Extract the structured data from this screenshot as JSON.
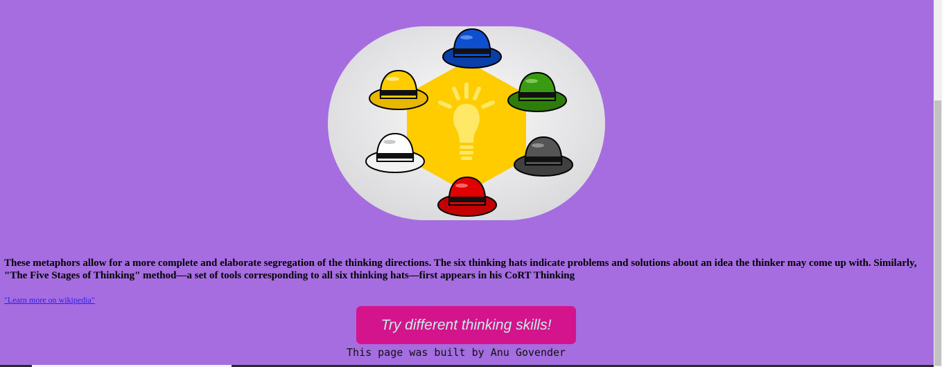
{
  "hero": {
    "image_alt": "six thinking hats around a lightbulb",
    "hats": [
      "blue-hat-icon",
      "green-hat-icon",
      "black-hat-icon",
      "red-hat-icon",
      "white-hat-icon",
      "yellow-hat-icon"
    ],
    "center_icon": "lightbulb-icon",
    "colors": {
      "background": "#a66de0",
      "oval": "#e6e6e8",
      "hexagon": "#ffcc00",
      "bulb": "#ffe866"
    }
  },
  "content": {
    "description": "These metaphors allow for a more complete and elaborate segregation of the thinking directions. The six thinking hats indicate problems and solutions about an idea the thinker may come up with. Similarly, \"The Five Stages of Thinking\" method—a set of tools corresponding to all six thinking hats—first appears in his CoRT Thinking",
    "wiki_link": "\"Learn more on wikipedia\""
  },
  "cta": {
    "label": "Try different thinking skills!",
    "color": "#d4148c"
  },
  "footer": {
    "text": "This page was built by Anu Govender"
  }
}
